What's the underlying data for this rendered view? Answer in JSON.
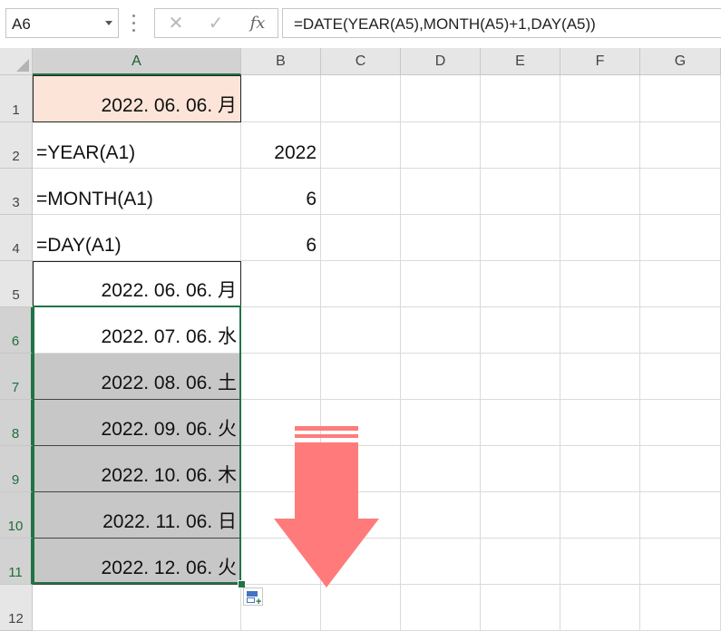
{
  "formula_bar": {
    "name_box": "A6",
    "cancel_glyph": "✕",
    "enter_glyph": "✓",
    "fx_label": "fx",
    "formula": "=DATE(YEAR(A5),MONTH(A5)+1,DAY(A5))"
  },
  "columns": [
    "A",
    "B",
    "C",
    "D",
    "E",
    "F",
    "G"
  ],
  "rows": [
    "1",
    "2",
    "3",
    "4",
    "5",
    "6",
    "7",
    "8",
    "9",
    "10",
    "11",
    "12"
  ],
  "cells": {
    "A1": "2022. 06. 06. 月",
    "A2": "=YEAR(A1)",
    "B2": "2022",
    "A3": "=MONTH(A1)",
    "B3": "6",
    "A4": "=DAY(A1)",
    "B4": "6",
    "A5": "2022. 06. 06. 月",
    "A6": "2022. 07. 06. 水",
    "A7": "2022. 08. 06. 土",
    "A8": "2022. 09. 06. 火",
    "A9": "2022. 10. 06. 木",
    "A10": "2022. 11. 06. 日",
    "A11": "2022. 12. 06. 火"
  },
  "selection": "A6:A11",
  "colors": {
    "selection_border": "#217346",
    "highlight_fill": "#fde4d8",
    "shaded_fill": "#c7c7c7",
    "arrow": "#ff7b7b"
  },
  "icons": {
    "autofill_options": "autofill-options-icon",
    "arrow": "down-arrow-icon"
  }
}
